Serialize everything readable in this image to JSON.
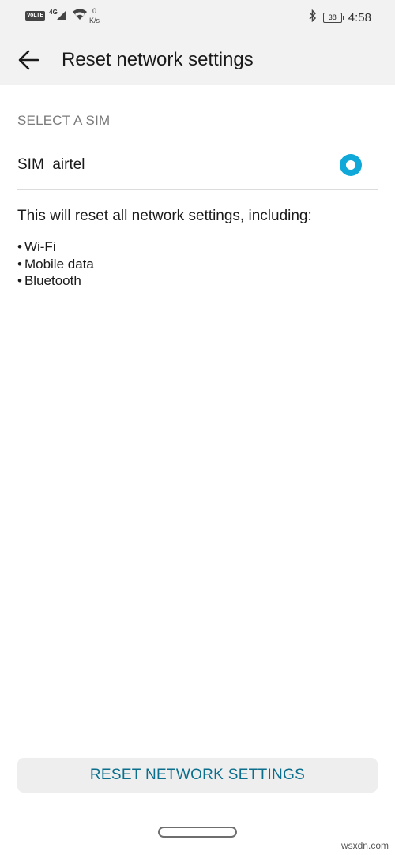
{
  "status_bar": {
    "volte": "VoLTE",
    "network": "4G",
    "speed_value": "0",
    "speed_unit": "K/s",
    "battery": "38",
    "time": "4:58",
    "icons": [
      "volte-icon",
      "signal-icon",
      "wifi-icon",
      "bluetooth-icon",
      "battery-icon"
    ]
  },
  "app_bar": {
    "title": "Reset network settings",
    "back_icon": "arrow-left-icon"
  },
  "sim_section": {
    "header": "SELECT A SIM",
    "sim_label": "SIM  airtel",
    "selected": true
  },
  "info": {
    "description": "This will reset all network settings, including:",
    "items": [
      "Wi-Fi",
      "Mobile data",
      "Bluetooth"
    ]
  },
  "action": {
    "button_label": "RESET NETWORK SETTINGS"
  },
  "watermark": "wsxdn.com",
  "colors": {
    "accent": "#0fa8d8",
    "button_text": "#0a6e8c",
    "bar_background": "#f2f2f2"
  }
}
